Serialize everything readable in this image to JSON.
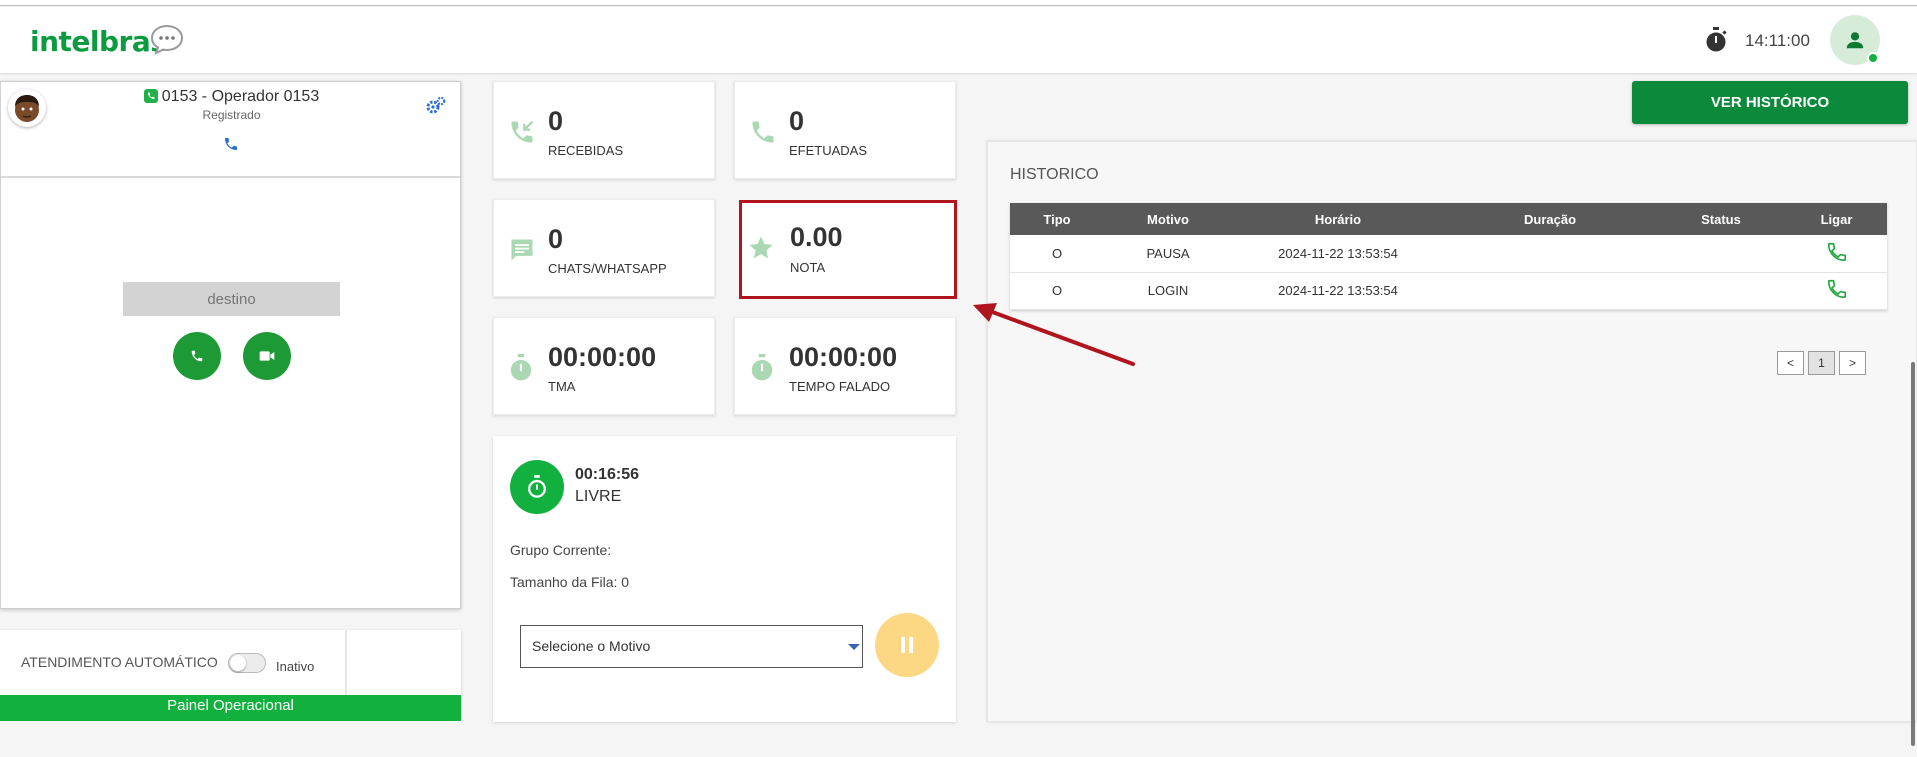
{
  "header": {
    "logo": "intelbras",
    "clock": "14:11:00"
  },
  "phone": {
    "operator_title": "0153 - Operador 0153",
    "status": "Registrado",
    "destination_placeholder": "destino"
  },
  "auto_answer": {
    "label": "ATENDIMENTO AUTOMÁTICO",
    "state": "Inativo"
  },
  "footer_bar": "Painel Operacional",
  "stats": {
    "recebidas": {
      "value": "0",
      "label": "RECEBIDAS"
    },
    "efetuadas": {
      "value": "0",
      "label": "EFETUADAS"
    },
    "chats": {
      "value": "0",
      "label": "CHATS/WHATSAPP"
    },
    "nota": {
      "value": "0.00",
      "label": "NOTA"
    },
    "tma": {
      "value": "00:00:00",
      "label": "TMA"
    },
    "tempo_falado": {
      "value": "00:00:00",
      "label": "TEMPO FALADO"
    }
  },
  "status_panel": {
    "time": "00:16:56",
    "state": "LIVRE",
    "grupo": "Grupo Corrente:",
    "fila": "Tamanho da Fila: 0",
    "motivo_placeholder": "Selecione o Motivo"
  },
  "history": {
    "button": "VER HISTÓRICO",
    "title": "HISTORICO",
    "columns": [
      "Tipo",
      "Motivo",
      "Horário",
      "Duração",
      "Status",
      "Ligar"
    ],
    "rows": [
      {
        "tipo": "O",
        "motivo": "PAUSA",
        "horario": "2024-11-22 13:53:54",
        "duracao": "",
        "status": ""
      },
      {
        "tipo": "O",
        "motivo": "LOGIN",
        "horario": "2024-11-22 13:53:54",
        "duracao": "",
        "status": ""
      }
    ],
    "pager": {
      "prev": "<",
      "current": "1",
      "next": ">"
    }
  },
  "colors": {
    "brand_green": "#0c9b3e",
    "highlight_red": "#b0141f",
    "pause_yellow": "#fdd884"
  }
}
